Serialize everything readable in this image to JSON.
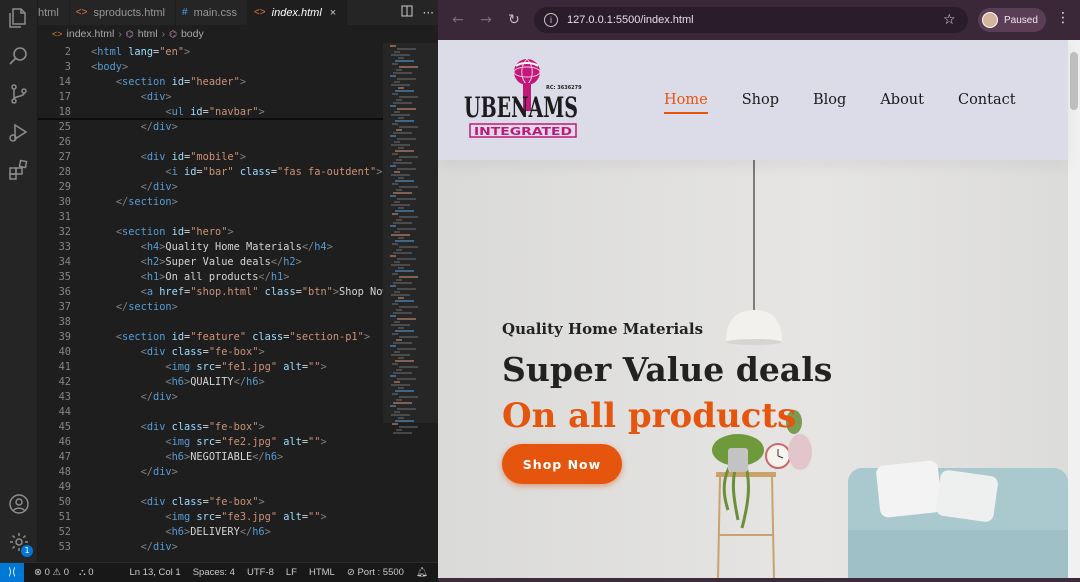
{
  "editor": {
    "tabs": [
      {
        "label": "html",
        "icon": "html-file-icon",
        "active": false
      },
      {
        "label": "sproducts.html",
        "icon": "html-file-icon",
        "active": false
      },
      {
        "label": "main.css",
        "icon": "css-file-icon",
        "active": false
      },
      {
        "label": "index.html",
        "icon": "html-file-icon",
        "active": true
      }
    ],
    "close_glyph": "×",
    "breadcrumb": [
      "index.html",
      "html",
      "body"
    ],
    "lines": [
      {
        "n": "2",
        "code": "<html lang=\"en\">"
      },
      {
        "n": "3",
        "code": "<body>"
      },
      {
        "n": "14",
        "code": "    <section id=\"header\">"
      },
      {
        "n": "17",
        "code": "        <div>"
      },
      {
        "n": "18",
        "code": "            <ul id=\"navbar\">"
      },
      {
        "n": "25",
        "code": "        </div>"
      },
      {
        "n": "26",
        "code": ""
      },
      {
        "n": "27",
        "code": "        <div id=\"mobile\">"
      },
      {
        "n": "28",
        "code": "            <i id=\"bar\" class=\"fas fa-outdent\"></i>"
      },
      {
        "n": "29",
        "code": "        </div>"
      },
      {
        "n": "30",
        "code": "    </section>"
      },
      {
        "n": "31",
        "code": ""
      },
      {
        "n": "32",
        "code": "    <section id=\"hero\">"
      },
      {
        "n": "33",
        "code": "        <h4>Quality Home Materials</h4>"
      },
      {
        "n": "34",
        "code": "        <h2>Super Value deals</h2>"
      },
      {
        "n": "35",
        "code": "        <h1>On all products</h1>"
      },
      {
        "n": "36",
        "code": "        <a href=\"shop.html\" class=\"btn\">Shop Now</a>"
      },
      {
        "n": "37",
        "code": "    </section>"
      },
      {
        "n": "38",
        "code": ""
      },
      {
        "n": "39",
        "code": "    <section id=\"feature\" class=\"section-p1\">"
      },
      {
        "n": "40",
        "code": "        <div class=\"fe-box\">"
      },
      {
        "n": "41",
        "code": "            <img src=\"fe1.jpg\" alt=\"\">"
      },
      {
        "n": "42",
        "code": "            <h6>QUALITY</h6>"
      },
      {
        "n": "43",
        "code": "        </div>"
      },
      {
        "n": "44",
        "code": ""
      },
      {
        "n": "45",
        "code": "        <div class=\"fe-box\">"
      },
      {
        "n": "46",
        "code": "            <img src=\"fe2.jpg\" alt=\"\">"
      },
      {
        "n": "47",
        "code": "            <h6>NEGOTIABLE</h6>"
      },
      {
        "n": "48",
        "code": "        </div>"
      },
      {
        "n": "49",
        "code": ""
      },
      {
        "n": "50",
        "code": "        <div class=\"fe-box\">"
      },
      {
        "n": "51",
        "code": "            <img src=\"fe3.jpg\" alt=\"\">"
      },
      {
        "n": "52",
        "code": "            <h6>DELIVERY</h6>"
      },
      {
        "n": "53",
        "code": "        </div>"
      }
    ],
    "status": {
      "errors": "0",
      "warnings": "0",
      "ports": "0",
      "position": "Ln 13, Col 1",
      "spaces": "Spaces: 4",
      "encoding": "UTF-8",
      "eol": "LF",
      "language": "HTML",
      "port": "Port : 5500"
    },
    "settings_badge": "1"
  },
  "browser": {
    "url": "127.0.0.1:5500/index.html",
    "profile_label": "Paused"
  },
  "site": {
    "logo": {
      "line1": "UBENAMS",
      "line2": "INTEGRATED",
      "rc": "RC: 3636279"
    },
    "nav": [
      {
        "label": "Home",
        "active": true
      },
      {
        "label": "Shop",
        "active": false
      },
      {
        "label": "Blog",
        "active": false
      },
      {
        "label": "About",
        "active": false
      },
      {
        "label": "Contact",
        "active": false
      }
    ],
    "hero": {
      "h4": "Quality Home Materials",
      "h2": "Super Value deals",
      "h1": "On all products",
      "button": "Shop Now"
    },
    "colors": {
      "accent": "#e6550d",
      "logo_pink": "#c2187a"
    }
  }
}
